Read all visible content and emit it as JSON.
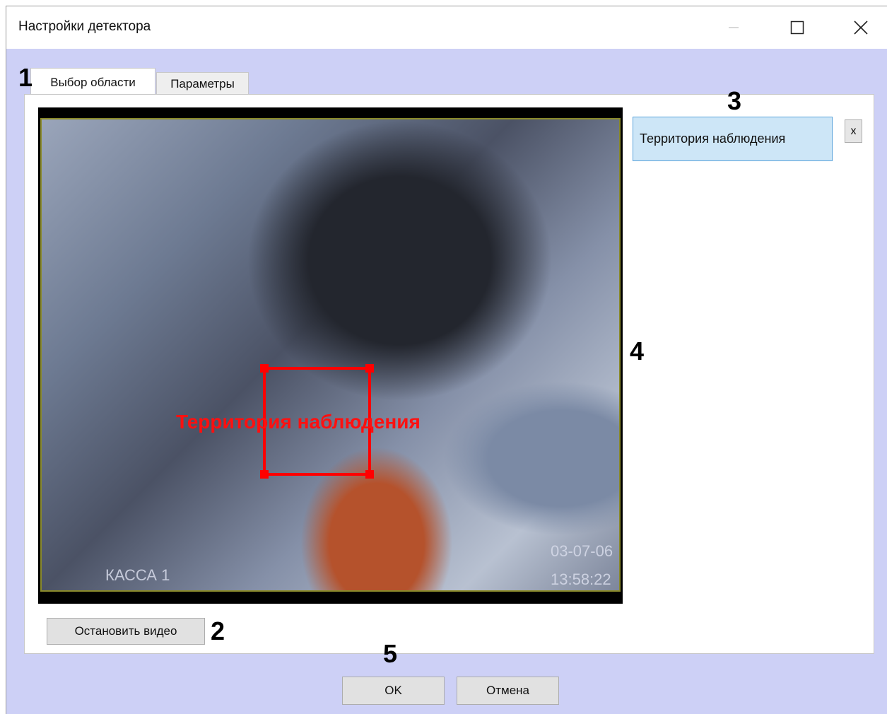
{
  "window": {
    "title": "Настройки детектора",
    "minimize_icon": "minimize-icon",
    "maximize_icon": "maximize-icon",
    "close_icon": "close-icon"
  },
  "tabs": [
    {
      "label": "Выбор области",
      "active": true
    },
    {
      "label": "Параметры",
      "active": false
    }
  ],
  "video": {
    "camera_label": "КАССА 1",
    "date": "03-07-06",
    "time": "13:58:22"
  },
  "zone": {
    "label": "Территория наблюдения",
    "color": "#ff0000"
  },
  "zone_list": {
    "items": [
      "Территория наблюдения"
    ],
    "delete_label": "x"
  },
  "buttons": {
    "stop_video": "Остановить видео",
    "ok": "OK",
    "cancel": "Отмена"
  },
  "callouts": [
    "1",
    "2",
    "3",
    "4",
    "5"
  ]
}
